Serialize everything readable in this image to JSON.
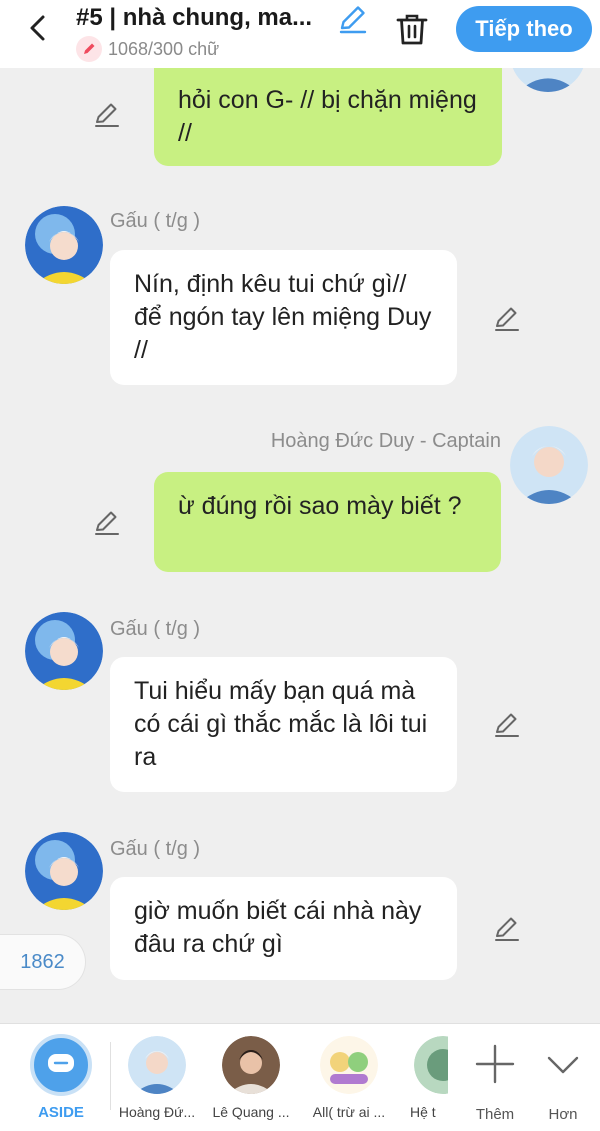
{
  "header": {
    "title": "#5 | nhà chung, ma...",
    "word_count": "1068/300 chữ",
    "next_label": "Tiếp theo"
  },
  "messages": [
    {
      "side": "right",
      "sender": "",
      "text": "hỏi con G- // bị chặn miệng //"
    },
    {
      "side": "left",
      "sender": "Gấu ( t/g )",
      "text": "Nín, định kêu tui chứ gì// để ngón tay lên miệng Duy //"
    },
    {
      "side": "right",
      "sender": "Hoàng Đức Duy - Captain",
      "text": "ừ đúng rồi sao mày biết ?"
    },
    {
      "side": "left",
      "sender": "Gấu ( t/g )",
      "text": "Tui hiểu mấy bạn quá mà có cái gì thắc mắc là lôi tui ra"
    },
    {
      "side": "left",
      "sender": "Gấu ( t/g )",
      "text": "giờ muốn biết cái nhà này đâu ra chứ gì"
    }
  ],
  "counter": "1862",
  "bottom_bar": {
    "aside_label": "ASIDE",
    "characters": [
      {
        "label": "Hoàng Đứ..."
      },
      {
        "label": "Lê Quang ..."
      },
      {
        "label": "All( trừ ai ..."
      },
      {
        "label": "Hệ t"
      }
    ],
    "add_label": "Thêm",
    "more_label": "Hơn"
  },
  "colors": {
    "accent": "#3e9cf0",
    "right_bubble": "#c8f082",
    "left_bubble": "#ffffff",
    "background": "#efefef"
  }
}
